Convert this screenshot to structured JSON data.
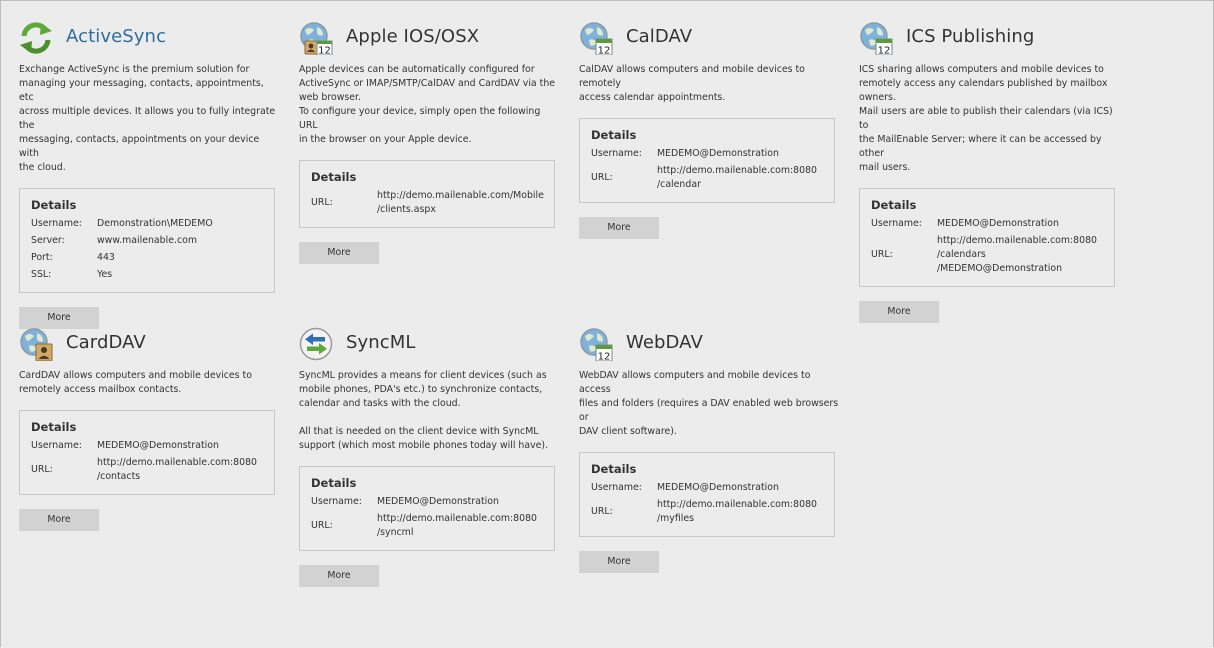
{
  "colors": {
    "background": "#ececec",
    "title_link": "#2d6e9e",
    "button": "#d2d2d2",
    "border": "#c8c8c8"
  },
  "details_heading": "Details",
  "more_label": "More",
  "cards": [
    {
      "title": "ActiveSync",
      "icon": "activesync-sync-icon",
      "description": "Exchange ActiveSync is the premium solution for\nmanaging your messaging, contacts, appointments, etc\nacross multiple devices. It allows you to fully integrate the\nmessaging, contacts, appointments on your device with\nthe cloud.",
      "details": [
        {
          "label": "Username:",
          "value": "Demonstration\\MEDEMO"
        },
        {
          "label": "Server:",
          "value": "www.mailenable.com"
        },
        {
          "label": "Port:",
          "value": "443"
        },
        {
          "label": "SSL:",
          "value": "Yes"
        }
      ]
    },
    {
      "title": "Apple IOS/OSX",
      "icon": "globe-contact-calendar-icon",
      "description": "Apple devices can be automatically configured for\nActiveSync or IMAP/SMTP/CalDAV and CardDAV via the\nweb browser.\nTo configure your device, simply open the following URL\nin the browser on your Apple device.",
      "details": [
        {
          "label": "URL:",
          "value": "http://demo.mailenable.com/Mobile\n/clients.aspx"
        }
      ]
    },
    {
      "title": "CalDAV",
      "icon": "globe-calendar-icon",
      "description": "CalDAV allows computers and mobile devices to remotely\naccess calendar appointments.",
      "details": [
        {
          "label": "Username:",
          "value": "MEDEMO@Demonstration"
        },
        {
          "label": "URL:",
          "value": "http://demo.mailenable.com:8080\n/calendar"
        }
      ]
    },
    {
      "title": "ICS Publishing",
      "icon": "globe-calendar-icon",
      "description": "ICS sharing allows computers and mobile devices to\nremotely access any calendars published by mailbox\nowners.\nMail users are able to publish their calendars (via ICS) to\nthe MailEnable Server; where it can be accessed by other\nmail users.",
      "details": [
        {
          "label": "Username:",
          "value": "MEDEMO@Demonstration"
        },
        {
          "label": "URL:",
          "value": "http://demo.mailenable.com:8080\n/calendars\n/MEDEMO@Demonstration"
        }
      ]
    },
    {
      "title": "CardDAV",
      "icon": "globe-contact-icon",
      "description": "CardDAV allows computers and mobile devices to\nremotely access mailbox contacts.",
      "details": [
        {
          "label": "Username:",
          "value": "MEDEMO@Demonstration"
        },
        {
          "label": "URL:",
          "value": "http://demo.mailenable.com:8080\n/contacts"
        }
      ]
    },
    {
      "title": "SyncML",
      "icon": "syncml-arrows-icon",
      "description": "SyncML provides a means for client devices (such as\nmobile phones, PDA's etc.) to synchronize contacts,\ncalendar and tasks with the cloud.\n\nAll that is needed on the client device with SyncML\nsupport (which most mobile phones today will have).",
      "details": [
        {
          "label": "Username:",
          "value": "MEDEMO@Demonstration"
        },
        {
          "label": "URL:",
          "value": "http://demo.mailenable.com:8080\n/syncml"
        }
      ]
    },
    {
      "title": "WebDAV",
      "icon": "globe-calendar-icon",
      "description": "WebDAV allows computers and mobile devices to access\nfiles and folders (requires a DAV enabled web browsers or\nDAV client software).",
      "details": [
        {
          "label": "Username:",
          "value": "MEDEMO@Demonstration"
        },
        {
          "label": "URL:",
          "value": "http://demo.mailenable.com:8080\n/myfiles"
        }
      ]
    }
  ]
}
